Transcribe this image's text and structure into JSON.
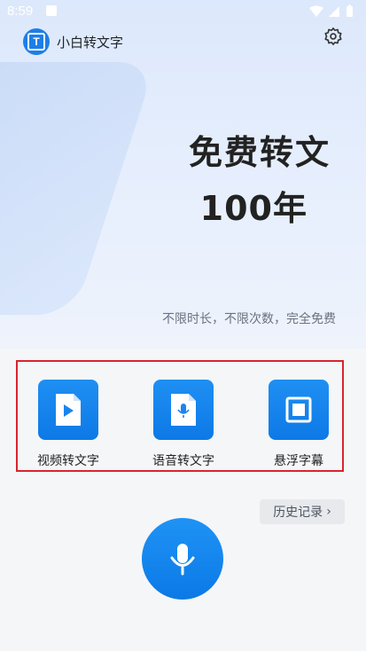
{
  "status_bar": {
    "time": "8:59"
  },
  "header": {
    "app_name": "小白转文字"
  },
  "promo": {
    "line1": "免费转文",
    "line2": "100年",
    "subtitle": "不限时长，不限次数，完全免费"
  },
  "features": [
    {
      "label": "视频转文字",
      "icon": "video-file-play-icon"
    },
    {
      "label": "语音转文字",
      "icon": "audio-file-mic-icon"
    },
    {
      "label": "悬浮字幕",
      "icon": "floating-window-icon"
    }
  ],
  "history": {
    "label": "历史记录",
    "chevron": "›"
  },
  "colors": {
    "primary": "#1a84ee",
    "highlight_border": "#d9242f"
  }
}
